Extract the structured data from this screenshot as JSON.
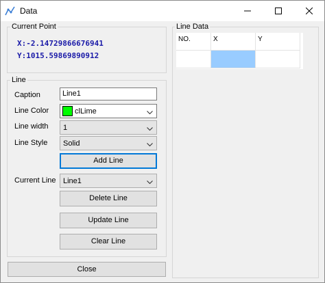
{
  "window": {
    "title": "Data",
    "icon": "chart-line-icon",
    "controls": [
      "minimize-icon",
      "maximize-icon",
      "close-icon"
    ]
  },
  "current_point": {
    "legend": "Current Point",
    "x_text": "X:-2.14729866676941",
    "y_text": "Y:1015.59869890912"
  },
  "line": {
    "legend": "Line",
    "caption_label": "Caption",
    "caption_value": "Line1",
    "color_label": "Line Color",
    "color_value": "clLime",
    "color_swatch": "#00ff00",
    "width_label": "Line width",
    "width_value": "1",
    "style_label": "Line Style",
    "style_value": "Solid",
    "add_button": "Add Line",
    "current_label": "Current Line",
    "current_value": "Line1",
    "delete_button": "Delete Line",
    "update_button": "Update Line",
    "clear_button": "Clear Line"
  },
  "close_button": "Close",
  "line_data": {
    "legend": "Line Data",
    "columns": [
      "NO.",
      "X",
      "Y"
    ],
    "rows": [
      [
        "",
        "",
        ""
      ]
    ]
  },
  "colors": {
    "coord_text": "#1a1aa8",
    "selection": "#99ccff",
    "default_button_border": "#0078d7"
  }
}
